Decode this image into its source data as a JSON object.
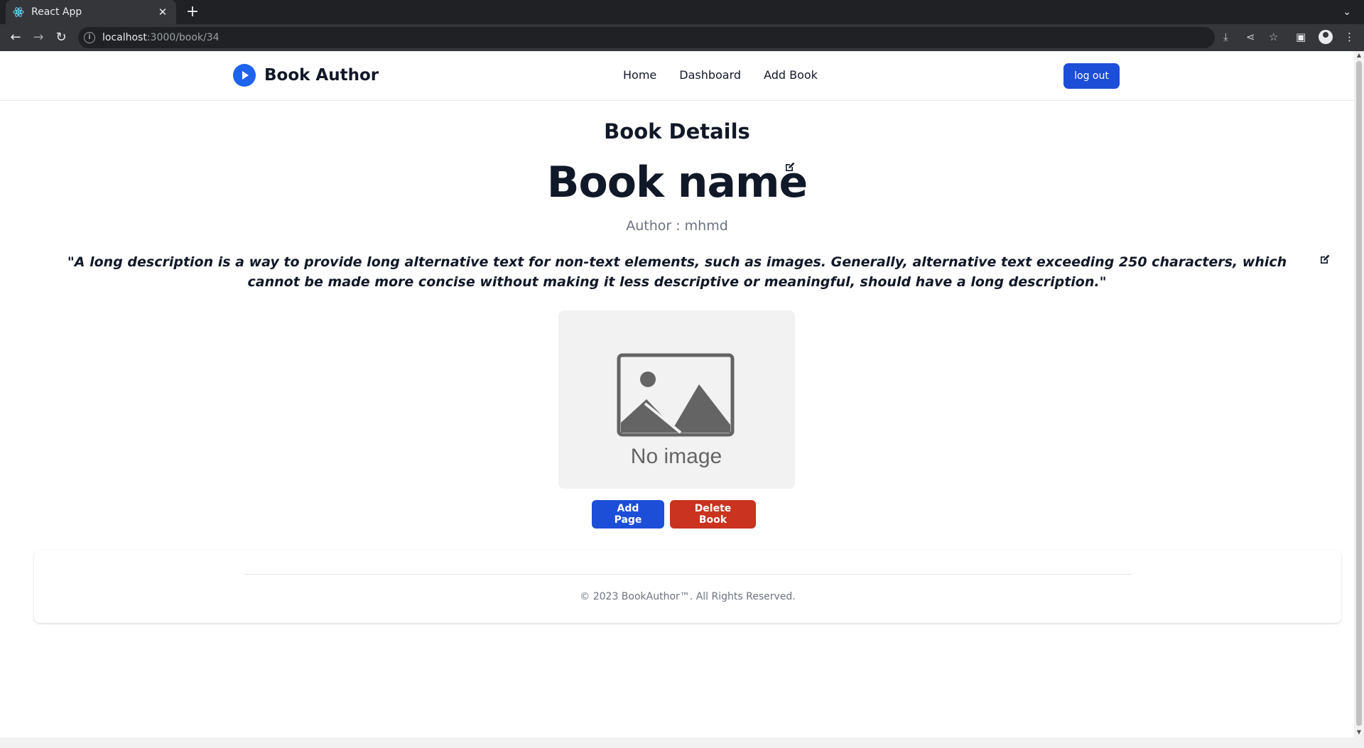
{
  "browser": {
    "tab_title": "React App",
    "url_host": "localhost",
    "url_path": ":3000/book/34"
  },
  "navbar": {
    "brand": "Book Author",
    "links": [
      "Home",
      "Dashboard",
      "Add Book"
    ],
    "logout_label": "log out"
  },
  "book": {
    "section_title": "Book Details",
    "title": "Book name",
    "author": "Author : mhmd",
    "description": "\"A long description is a way to provide long alternative text for non-text elements, such as images. Generally, alternative text exceeding 250 characters, which cannot be made more concise without making it less descriptive or meaningful, should have a long description.\"",
    "image_placeholder": "No image"
  },
  "actions": {
    "add_page": "Add Page",
    "delete_book": "Delete Book"
  },
  "footer": {
    "copyright": "© 2023 BookAuthor™. All Rights Reserved."
  },
  "colors": {
    "primary": "#1d4ed8",
    "danger": "#c9331f",
    "text": "#111827",
    "muted": "#6b7280"
  },
  "icons": {
    "tab_favicon": "react-icon",
    "brand_logo": "play-circle-icon",
    "edit": "edit-icon",
    "placeholder": "image-placeholder-icon"
  }
}
